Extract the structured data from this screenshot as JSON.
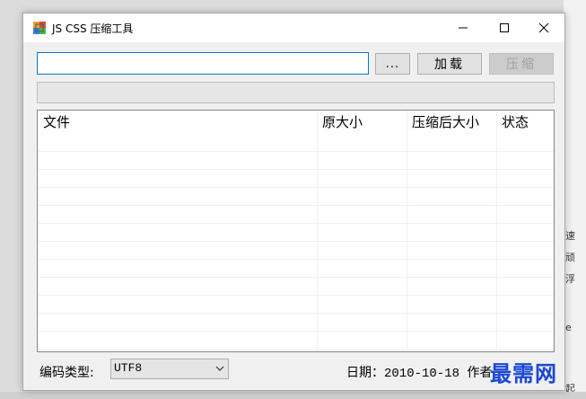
{
  "window": {
    "title": "JS CSS 压缩工具"
  },
  "toolbar": {
    "path_value": "",
    "browse_label": "...",
    "load_label": "加载",
    "compress_label": "压缩",
    "compress_enabled": false
  },
  "progress": {
    "fraction": 0
  },
  "listview": {
    "columns": [
      "文件",
      "原大小",
      "压缩后大小",
      "状态"
    ],
    "rows": []
  },
  "footer": {
    "encoding_label": "编码类型:",
    "encoding_value": "UTF8",
    "date_author_text": "日期：2010-10-18 作者"
  },
  "watermark": {
    "text": "最需网"
  },
  "desktop": {
    "strip_texts": [
      "速",
      "顽",
      "浮",
      "e",
      "起"
    ]
  },
  "colors": {
    "focus_border": "#0078d7",
    "watermark": "#1a47d6",
    "progress_fill": "#06b025"
  }
}
